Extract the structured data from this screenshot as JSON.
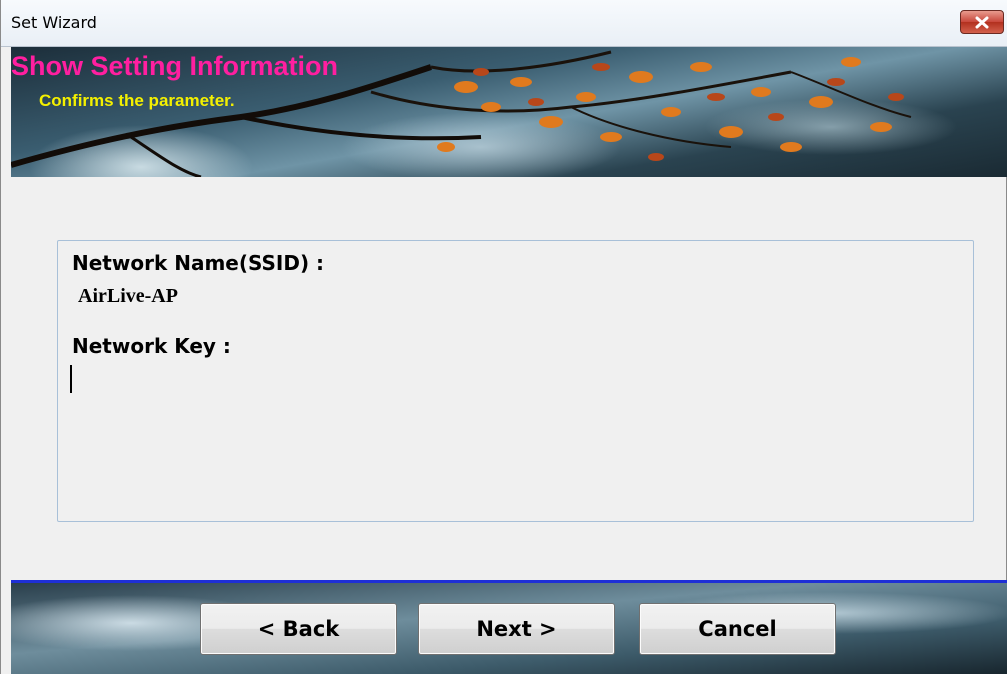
{
  "window": {
    "title": "Set Wizard"
  },
  "banner": {
    "title": "Show Setting Information",
    "subtitle": "Confirms the parameter.",
    "title_color": "#ff1fa0",
    "subtitle_color": "#f4f000"
  },
  "info": {
    "ssid_label": "Network Name(SSID) :",
    "ssid_value": "AirLive-AP",
    "key_label": "Network Key :",
    "key_value": ""
  },
  "buttons": {
    "back": "< Back",
    "next": "Next >",
    "cancel": "Cancel"
  },
  "icons": {
    "close": "close-icon"
  },
  "colors": {
    "separator": "#1e2fd6"
  }
}
